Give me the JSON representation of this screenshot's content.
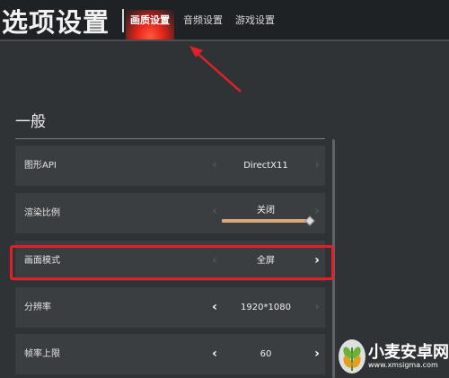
{
  "header": {
    "title": "选项设置",
    "tabs": [
      {
        "label": "画质设置",
        "active": true
      },
      {
        "label": "音频设置",
        "active": false
      },
      {
        "label": "游戏设置",
        "active": false
      }
    ]
  },
  "section": {
    "title": "一般"
  },
  "rows": [
    {
      "label": "图形API",
      "value": "DirectX11"
    },
    {
      "label": "渲染比例",
      "value": "关闭"
    },
    {
      "label": "画面模式",
      "value": "全屏"
    },
    {
      "label": "分辨率",
      "value": "1920*1080"
    },
    {
      "label": "帧率上限",
      "value": "60"
    }
  ],
  "icons": {
    "left": "‹",
    "right": "›"
  },
  "watermark": {
    "name": "小麦安卓网",
    "url": "www.xmsigma.com"
  },
  "colors": {
    "accent": "#e2231a",
    "highlight_box": "#e3202a",
    "slider": "#d9a77a"
  }
}
